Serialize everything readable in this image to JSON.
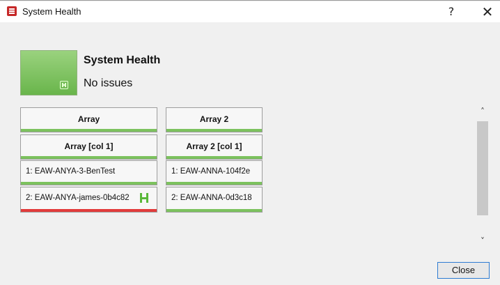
{
  "window": {
    "title": "System Health",
    "help_label": "?",
    "close_label": "✕"
  },
  "status": {
    "title": "System Health",
    "subtitle": "No issues",
    "tile_color": "#7cc25e"
  },
  "columns": [
    {
      "header": "Array",
      "subheader": "Array [col 1]",
      "items": [
        {
          "label": "1: EAW-ANYA-3-BenTest",
          "status": "green"
        },
        {
          "label": "2: EAW-ANYA-james-0b4c82",
          "status": "red",
          "icon": "healthy-icon"
        }
      ]
    },
    {
      "header": "Array 2",
      "subheader": "Array 2 [col 1]",
      "items": [
        {
          "label": "1: EAW-ANNA-104f2e",
          "status": "green"
        },
        {
          "label": "2: EAW-ANNA-0d3c18",
          "status": "green"
        }
      ]
    }
  ],
  "scrollbar": {
    "up": "˄",
    "down": "˅"
  },
  "footer": {
    "close_button": "Close"
  },
  "colors": {
    "ok": "#7cc25e",
    "error": "#e23b3b",
    "accent": "#2d7bd2"
  }
}
